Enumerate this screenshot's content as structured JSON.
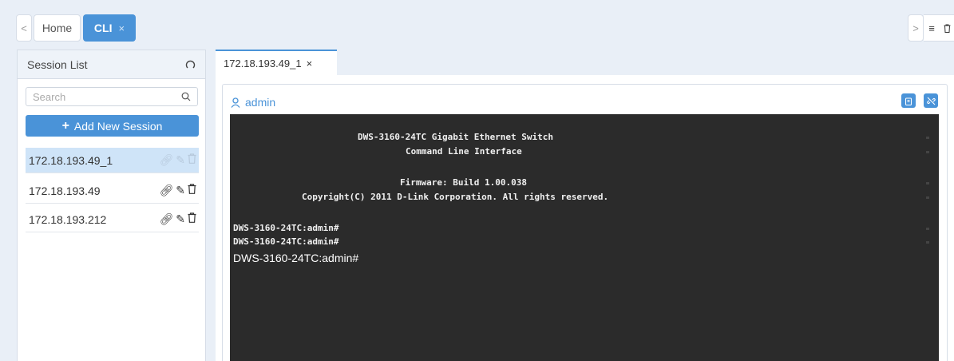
{
  "topbar": {
    "left_arrow": "<",
    "tabs": [
      {
        "label": "Home"
      },
      {
        "label": "CLI",
        "close": "×"
      }
    ],
    "right_arrow": ">",
    "menu_icon": "≡",
    "trash_icon": "trash-icon"
  },
  "sidebar": {
    "title": "Session List",
    "refresh_icon": "refresh-icon",
    "search_placeholder": "Search",
    "add_button": "Add New Session",
    "sessions": [
      {
        "name": "172.18.193.49_1",
        "active": true
      },
      {
        "name": "172.18.193.49",
        "active": false
      },
      {
        "name": "172.18.193.212",
        "active": false
      }
    ]
  },
  "session_tab": {
    "label": "172.18.193.49_1",
    "close": "×"
  },
  "terminal_header": {
    "user": "admin"
  },
  "terminal": {
    "lines": [
      "DWS-3160-24TC Gigabit Ethernet Switch",
      "Command Line Interface",
      "Firmware: Build 1.00.038",
      "Copyright(C) 2011 D-Link Corporation. All rights reserved.",
      "DWS-3160-24TC:admin#",
      "DWS-3160-24TC:admin#",
      "DWS-3160-24TC:admin#"
    ]
  }
}
